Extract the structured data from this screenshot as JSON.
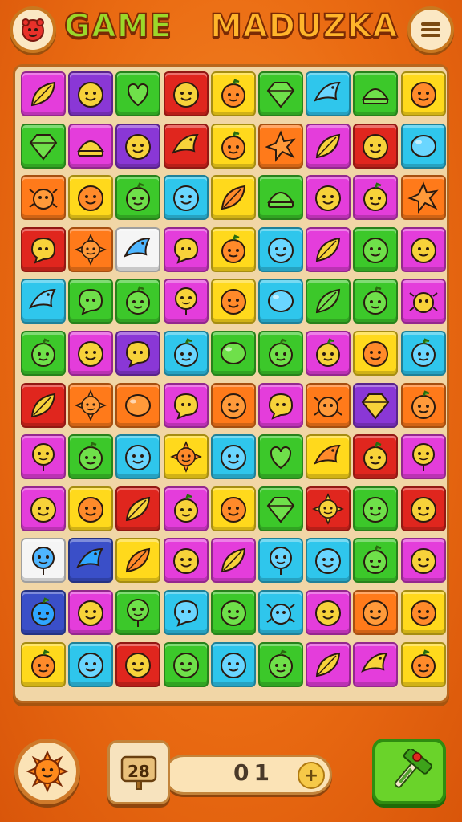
{
  "header": {
    "title_part1": "GAME",
    "title_part2": "MADUZKA",
    "logo_icon": "cute-blob-icon",
    "menu_icon": "hamburger-menu-icon"
  },
  "board": {
    "rows": 12,
    "cols": 9,
    "tiles": [
      [
        "magenta:leaf",
        "purple:smile",
        "green:heart",
        "red:smile",
        "yellow:fruit",
        "green:gem",
        "cyan:bird",
        "green:shell",
        "yellow:smile"
      ],
      [
        "green:gem",
        "magenta:shell",
        "purple:smile",
        "red:bird",
        "yellow:fruit",
        "orange:star",
        "magenta:leaf",
        "red:smile",
        "cyan:orb"
      ],
      [
        "orange:bug",
        "yellow:smile",
        "green:fruit",
        "cyan:smile",
        "yellow:leaf",
        "green:shell",
        "magenta:smile",
        "magenta:fruit",
        "orange:star"
      ],
      [
        "red:chat",
        "orange:sun",
        "white:bird",
        "magenta:chat",
        "yellow:fruit",
        "cyan:smile",
        "magenta:leaf",
        "green:smile",
        "magenta:smile"
      ],
      [
        "cyan:bird",
        "green:chat",
        "green:fruit",
        "magenta:balloon",
        "yellow:smile",
        "cyan:orb",
        "green:leaf",
        "green:fruit",
        "magenta:bug"
      ],
      [
        "green:fruit",
        "magenta:smile",
        "purple:chat",
        "cyan:fruit",
        "green:orb",
        "green:fruit",
        "magenta:fruit",
        "yellow:smile",
        "cyan:fruit"
      ],
      [
        "red:leaf",
        "orange:sun",
        "orange:orb",
        "magenta:chat",
        "orange:smile",
        "magenta:chat",
        "orange:bug",
        "purple:gem",
        "orange:fruit"
      ],
      [
        "magenta:balloon",
        "green:fruit",
        "cyan:smile",
        "yellow:sun",
        "cyan:smile",
        "green:heart",
        "yellow:bird",
        "red:fruit",
        "magenta:balloon"
      ],
      [
        "magenta:smile",
        "yellow:smile",
        "red:leaf",
        "magenta:fruit",
        "yellow:smile",
        "green:gem",
        "red:sun",
        "green:smile",
        "red:smile"
      ],
      [
        "white:balloon",
        "blue:bird",
        "yellow:leaf",
        "magenta:smile",
        "magenta:leaf",
        "cyan:balloon",
        "cyan:smile",
        "green:fruit",
        "magenta:smile"
      ],
      [
        "blue:fruit",
        "magenta:smile",
        "green:balloon",
        "cyan:chat",
        "green:smile",
        "cyan:bug",
        "magenta:smile",
        "orange:smile",
        "yellow:smile"
      ],
      [
        "yellow:fruit",
        "cyan:smile",
        "red:smile",
        "green:smile",
        "cyan:smile",
        "green:fruit",
        "magenta:leaf",
        "magenta:bird",
        "yellow:fruit"
      ]
    ]
  },
  "palette": {
    "magenta": "#e43ddb",
    "purple": "#8a37d6",
    "green": "#3cc82a",
    "red": "#e0261e",
    "yellow": "#ffd91c",
    "cyan": "#2fc6ec",
    "orange": "#ff7a1a",
    "white": "#f5f5f5",
    "blue": "#3a4fc8"
  },
  "footer": {
    "power_icon": "sun-creature-icon",
    "level_icon": "level-badge-icon",
    "level_text": "28",
    "score_value": "01",
    "plus_icon": "plus-icon",
    "plus_label": "+",
    "hammer_icon": "hammer-tool-icon"
  }
}
